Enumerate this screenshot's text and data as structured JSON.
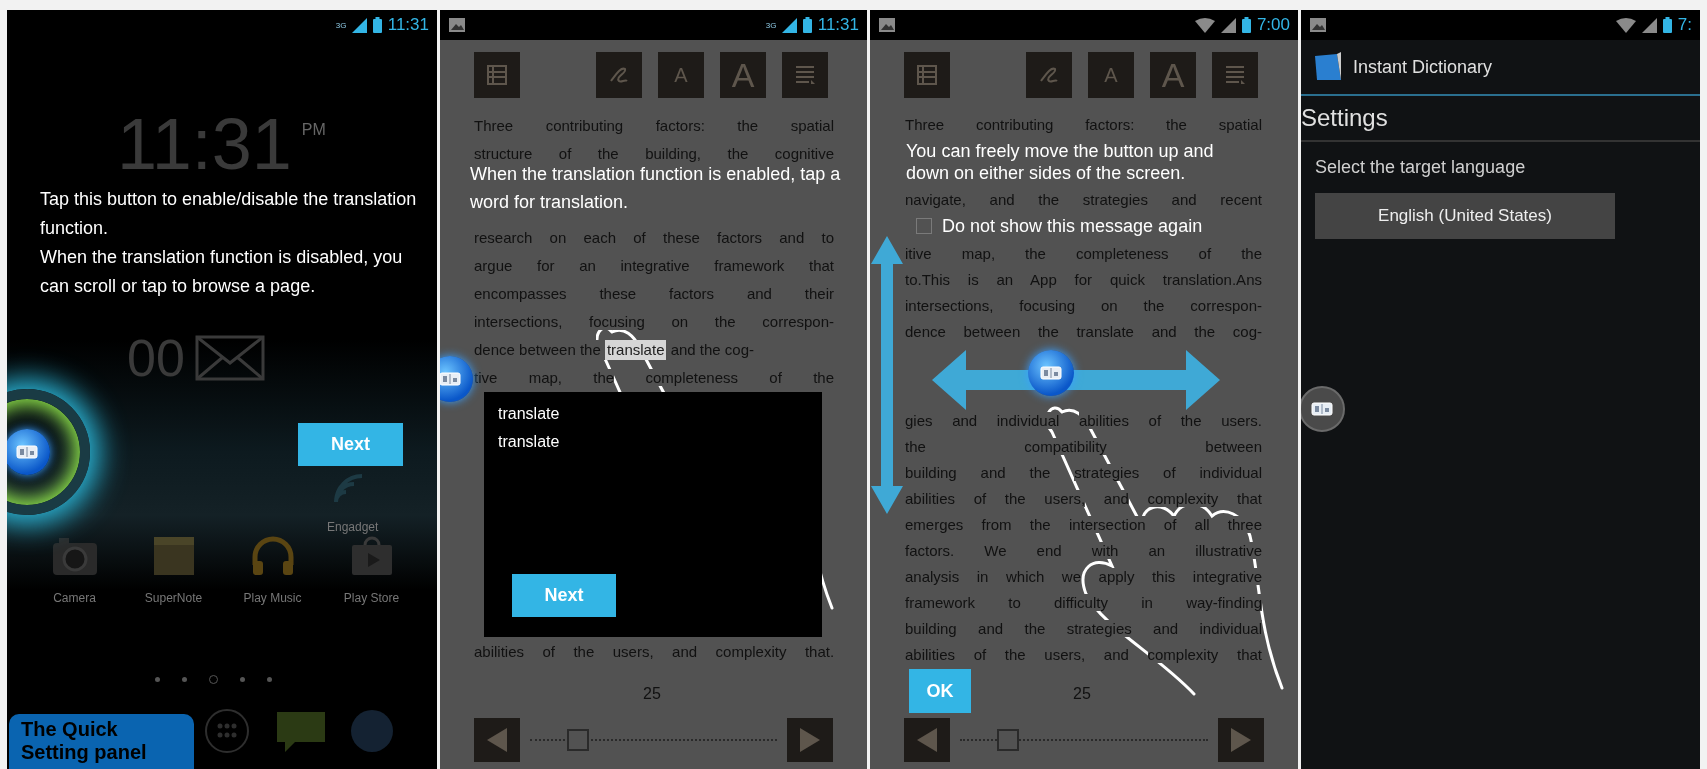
{
  "panels": [
    {
      "kind": "home",
      "status_bar": {
        "notification_icon": false,
        "network_label": "3G",
        "wifi": false,
        "time": "11:31"
      },
      "clock": {
        "time": "11:31",
        "meridiem": "PM"
      },
      "mail_widget": {
        "count": "00"
      },
      "widget_labels": [
        "Engadget"
      ],
      "dock_apps": [
        {
          "kind": "camera",
          "label": "Camera"
        },
        {
          "kind": "notes",
          "label": "SuperNote"
        },
        {
          "kind": "music",
          "label": "Play Music"
        },
        {
          "kind": "store",
          "label": "Play Store"
        }
      ],
      "page_dots": [
        {
          "selected": false
        },
        {
          "selected": false
        },
        {
          "selected": true
        },
        {
          "selected": false
        },
        {
          "selected": false
        }
      ],
      "coach_text": [
        "Tap this button to enable/disable the translation function.",
        "When the translation function is disabled, you can scroll or tap to browse a page."
      ],
      "next_button": "Next",
      "floating_button": {
        "enabled": true,
        "highlighted": true
      }
    },
    {
      "kind": "reader",
      "status_bar": {
        "notification_icon": true,
        "network_label": "3G",
        "wifi": false,
        "time": "11:31"
      },
      "toolbar": [
        {
          "kind": "toc"
        },
        {
          "kind": "pen"
        },
        {
          "kind": "font_small",
          "glyph": "A"
        },
        {
          "kind": "font_large",
          "glyph": "A"
        },
        {
          "kind": "menu"
        }
      ],
      "text_blocks": [
        {
          "kind": "top",
          "lines": [
            "Three contributing factors: the spatial",
            "structure of the building, the cognitive"
          ]
        },
        {
          "kind": "after_caption",
          "lines": [
            "research on each of these factors and to",
            "argue for an integrative framework that",
            "encompasses these factors and their",
            "intersections, focusing on the correspon-",
            {
              "segments": [
                {
                  "text": "dence between the ",
                  "selected": false
                },
                {
                  "text": "translate",
                  "selected": true
                },
                {
                  "text": " and the cog-",
                  "selected": false
                }
              ]
            },
            "tive map, the completeness of the"
          ]
        },
        {
          "kind": "after_popup",
          "lines": [
            "abilities of the users, and complexity that."
          ]
        }
      ],
      "coach_text": [
        "When the translation function is enabled, tap a word for translation."
      ],
      "popup": {
        "items": [
          "translate",
          "translate"
        ],
        "button": "Next"
      },
      "gesture_drawing": {
        "kind": "tap"
      },
      "page_number": "25",
      "page_slider": {
        "level": 0.15
      },
      "floating_button": {
        "enabled": true,
        "highlighted": false
      }
    },
    {
      "kind": "reader",
      "status_bar": {
        "notification_icon": true,
        "wifi": true,
        "time": "7:00"
      },
      "toolbar": [
        {
          "kind": "toc"
        },
        {
          "kind": "pen"
        },
        {
          "kind": "font_small",
          "glyph": "A"
        },
        {
          "kind": "font_large",
          "glyph": "A"
        },
        {
          "kind": "menu"
        }
      ],
      "text_blocks": [
        {
          "kind": "top",
          "lines": [
            "Three contributing factors: the spatial"
          ]
        },
        {
          "kind": "after_caption",
          "lines": [
            "navigate, and the strategies and recent"
          ]
        },
        {
          "kind": "after_checkbox",
          "lines": [
            "itive map, the completeness of the",
            "to.This is an App for quick translation.Ans",
            "intersections, focusing on the correspon-",
            "dence between the translate and the cog-"
          ]
        },
        {
          "kind": "after_arrows",
          "lines": [
            "gies and individual abilities of the users.",
            "the compatibility between",
            "building and the strategies of individual",
            "abilities of the users, and complexity that",
            "emerges from the intersection of all three",
            "factors. We end with an illustrative",
            "analysis in which we apply this integrative",
            "framework to difficulty in way-finding",
            "building and the strategies and individual",
            "abilities of the users, and complexity that"
          ]
        }
      ],
      "coach_text": [
        "You can freely move the button up and down on either sides of the screen."
      ],
      "checkbox": {
        "label": "Do not show this message again",
        "checked": false
      },
      "ok_button": "OK",
      "gesture_drawing": {
        "kind": "drag"
      },
      "page_number": "25",
      "page_slider": {
        "level": 0.15
      },
      "floating_button": {
        "enabled": true,
        "highlighted": false
      }
    },
    {
      "kind": "settings",
      "status_bar": {
        "notification_icon": true,
        "wifi": true,
        "time": "7:"
      },
      "app_title": "Instant Dictionary",
      "heading": "Settings",
      "label": "Select the target language",
      "language_button": "English (United States)",
      "floating_button": {
        "enabled": false,
        "highlighted": false
      }
    }
  ],
  "caption_badge": "The Quick Setting panel"
}
